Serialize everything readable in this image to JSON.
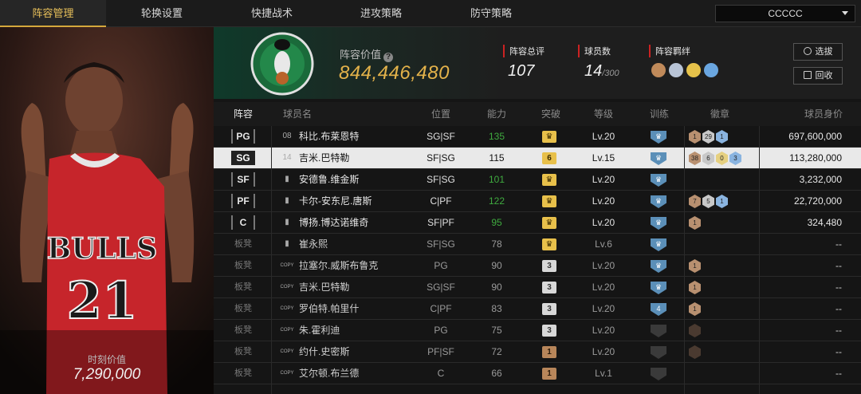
{
  "tabs": [
    {
      "label": "阵容管理",
      "active": true
    },
    {
      "label": "轮换设置",
      "active": false
    },
    {
      "label": "快捷战术",
      "active": false
    },
    {
      "label": "进攻策略",
      "active": false
    },
    {
      "label": "防守策略",
      "active": false
    }
  ],
  "team_select": {
    "value": "CCCCC"
  },
  "portrait": {
    "moment_label": "时刻价值",
    "moment_value": "7,290,000"
  },
  "header": {
    "value_label": "阵容价值",
    "value_amount": "844,446,480",
    "rating_label": "阵容总评",
    "rating_value": "107",
    "count_label": "球员数",
    "count_value": "14",
    "count_max": "/300",
    "bond_label": "阵容羁绊",
    "bond_colors": [
      "#c08a5a",
      "#b8c4d6",
      "#e6c24a",
      "#6aa6e0"
    ],
    "select_btn": "选拔",
    "recycle_btn": "回收"
  },
  "columns": [
    "阵容",
    "球员名",
    "位置",
    "能力",
    "突破",
    "等级",
    "训练",
    "徽章",
    "球员身价"
  ],
  "rows": [
    {
      "slot": "PG",
      "bench": false,
      "num": "08",
      "name": "科比.布莱恩特",
      "pos": "SG|SF",
      "ability": "135",
      "ability_color": "green",
      "break": "crown",
      "break_color": "gold",
      "level": "Lv.20",
      "train": "crown",
      "train_color": "#5b8fb8",
      "emblems": [
        {
          "v": "1",
          "c": "#b89070"
        },
        {
          "v": "29",
          "c": "#c8c8c8"
        },
        {
          "v": "1",
          "c": "#8ab4e0"
        }
      ],
      "worth": "697,600,000",
      "selected": false
    },
    {
      "slot": "SG",
      "bench": false,
      "num": "14",
      "name": "吉米.巴特勒",
      "pos": "SF|SG",
      "ability": "115",
      "ability_color": "white",
      "break": "6",
      "break_color": "gold",
      "level": "Lv.15",
      "train": "crown",
      "train_color": "#5b8fb8",
      "emblems": [
        {
          "v": "38",
          "c": "#b89070"
        },
        {
          "v": "6",
          "c": "#c8c8c8"
        },
        {
          "v": "0",
          "c": "#e6d080"
        },
        {
          "v": "3",
          "c": "#8ab4e0"
        }
      ],
      "worth": "113,280,000",
      "selected": true
    },
    {
      "slot": "SF",
      "bench": false,
      "num": "",
      "name": "安德鲁.维金斯",
      "pos": "SF|SG",
      "ability": "101",
      "ability_color": "green",
      "break": "crown",
      "break_color": "gold",
      "level": "Lv.20",
      "train": "crown",
      "train_color": "#5b8fb8",
      "emblems": [],
      "worth": "3,232,000",
      "selected": false
    },
    {
      "slot": "PF",
      "bench": false,
      "num": "",
      "name": "卡尔-安东尼.唐斯",
      "pos": "C|PF",
      "ability": "122",
      "ability_color": "green",
      "break": "crown",
      "break_color": "gold",
      "level": "Lv.20",
      "train": "crown",
      "train_color": "#5b8fb8",
      "emblems": [
        {
          "v": "7",
          "c": "#b89070"
        },
        {
          "v": "5",
          "c": "#c8c8c8"
        },
        {
          "v": "1",
          "c": "#8ab4e0"
        }
      ],
      "worth": "22,720,000",
      "selected": false
    },
    {
      "slot": "C",
      "bench": false,
      "num": "",
      "name": "博扬.博达诺维奇",
      "pos": "SF|PF",
      "ability": "95",
      "ability_color": "green",
      "break": "crown",
      "break_color": "gold",
      "level": "Lv.20",
      "train": "crown",
      "train_color": "#5b8fb8",
      "emblems": [
        {
          "v": "1",
          "c": "#b89070"
        }
      ],
      "worth": "324,480",
      "selected": false
    },
    {
      "slot": "板凳",
      "bench": true,
      "num": "",
      "name": "崔永熙",
      "pos": "SF|SG",
      "ability": "78",
      "ability_color": "green",
      "break": "crown",
      "break_color": "gold",
      "level": "Lv.6",
      "train": "crown",
      "train_color": "#5b8fb8",
      "emblems": [],
      "worth": "--",
      "selected": false
    },
    {
      "slot": "板凳",
      "bench": true,
      "num": "COPY",
      "name": "拉塞尔.威斯布鲁克",
      "pos": "PG",
      "ability": "90",
      "ability_color": "green",
      "break": "3",
      "break_color": "silver",
      "level": "Lv.20",
      "train": "crown",
      "train_color": "#5b8fb8",
      "emblems": [
        {
          "v": "1",
          "c": "#b89070"
        }
      ],
      "worth": "--",
      "selected": false
    },
    {
      "slot": "板凳",
      "bench": true,
      "num": "COPY",
      "name": "吉米.巴特勒",
      "pos": "SG|SF",
      "ability": "90",
      "ability_color": "green",
      "break": "3",
      "break_color": "silver",
      "level": "Lv.20",
      "train": "crown",
      "train_color": "#5b8fb8",
      "emblems": [
        {
          "v": "1",
          "c": "#b89070"
        }
      ],
      "worth": "--",
      "selected": false
    },
    {
      "slot": "板凳",
      "bench": true,
      "num": "COPY",
      "name": "罗伯特.帕里什",
      "pos": "C|PF",
      "ability": "83",
      "ability_color": "green",
      "break": "3",
      "break_color": "silver",
      "level": "Lv.20",
      "train": "4",
      "train_color": "#5b8fb8",
      "emblems": [
        {
          "v": "1",
          "c": "#b89070"
        }
      ],
      "worth": "--",
      "selected": false
    },
    {
      "slot": "板凳",
      "bench": true,
      "num": "COPY",
      "name": "朱.霍利迪",
      "pos": "PG",
      "ability": "75",
      "ability_color": "green",
      "break": "3",
      "break_color": "silver",
      "level": "Lv.20",
      "train": "",
      "train_color": "#3a3a3a",
      "emblems": [
        {
          "v": "",
          "c": "#4a3a30"
        }
      ],
      "worth": "--",
      "selected": false
    },
    {
      "slot": "板凳",
      "bench": true,
      "num": "COPY",
      "name": "约什.史密斯",
      "pos": "PF|SF",
      "ability": "72",
      "ability_color": "white",
      "break": "1",
      "break_color": "bronze",
      "level": "Lv.20",
      "train": "",
      "train_color": "#3a3a3a",
      "emblems": [
        {
          "v": "",
          "c": "#4a3a30"
        }
      ],
      "worth": "--",
      "selected": false
    },
    {
      "slot": "板凳",
      "bench": true,
      "num": "COPY",
      "name": "艾尔顿.布兰德",
      "pos": "C",
      "ability": "66",
      "ability_color": "white",
      "break": "1",
      "break_color": "bronze",
      "level": "Lv.1",
      "train": "",
      "train_color": "#3a3a3a",
      "emblems": [],
      "worth": "--",
      "selected": false
    }
  ]
}
